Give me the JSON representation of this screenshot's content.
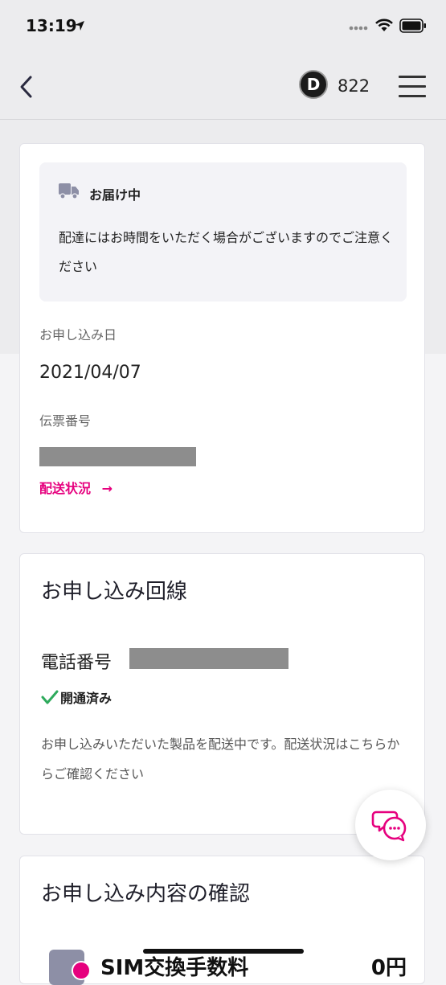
{
  "status_bar": {
    "time": "13:19"
  },
  "nav": {
    "points_badge": "D",
    "points": "822"
  },
  "delivery_card": {
    "notice_title": "お届け中",
    "notice_body": "配達にはお時間をいただく場合がございますのでご注意ください",
    "apply_date_label": "お申し込み日",
    "apply_date": "2021/04/07",
    "slip_number_label": "伝票番号",
    "status_link": "配送状況",
    "status_link_arrow": "→"
  },
  "line_card": {
    "title": "お申し込み回線",
    "phone_label": "電話番号",
    "activated": "開通済み",
    "note": "お申し込みいただいた製品を配送中です。配送状況はこちらからご確認ください"
  },
  "confirm_card": {
    "title": "お申し込み内容の確認",
    "row_label": "SIM交換手数料",
    "row_price": "0円"
  },
  "colors": {
    "accent": "#e6007e",
    "check": "#2eaa5c",
    "icon_gray": "#8d8fa6"
  }
}
